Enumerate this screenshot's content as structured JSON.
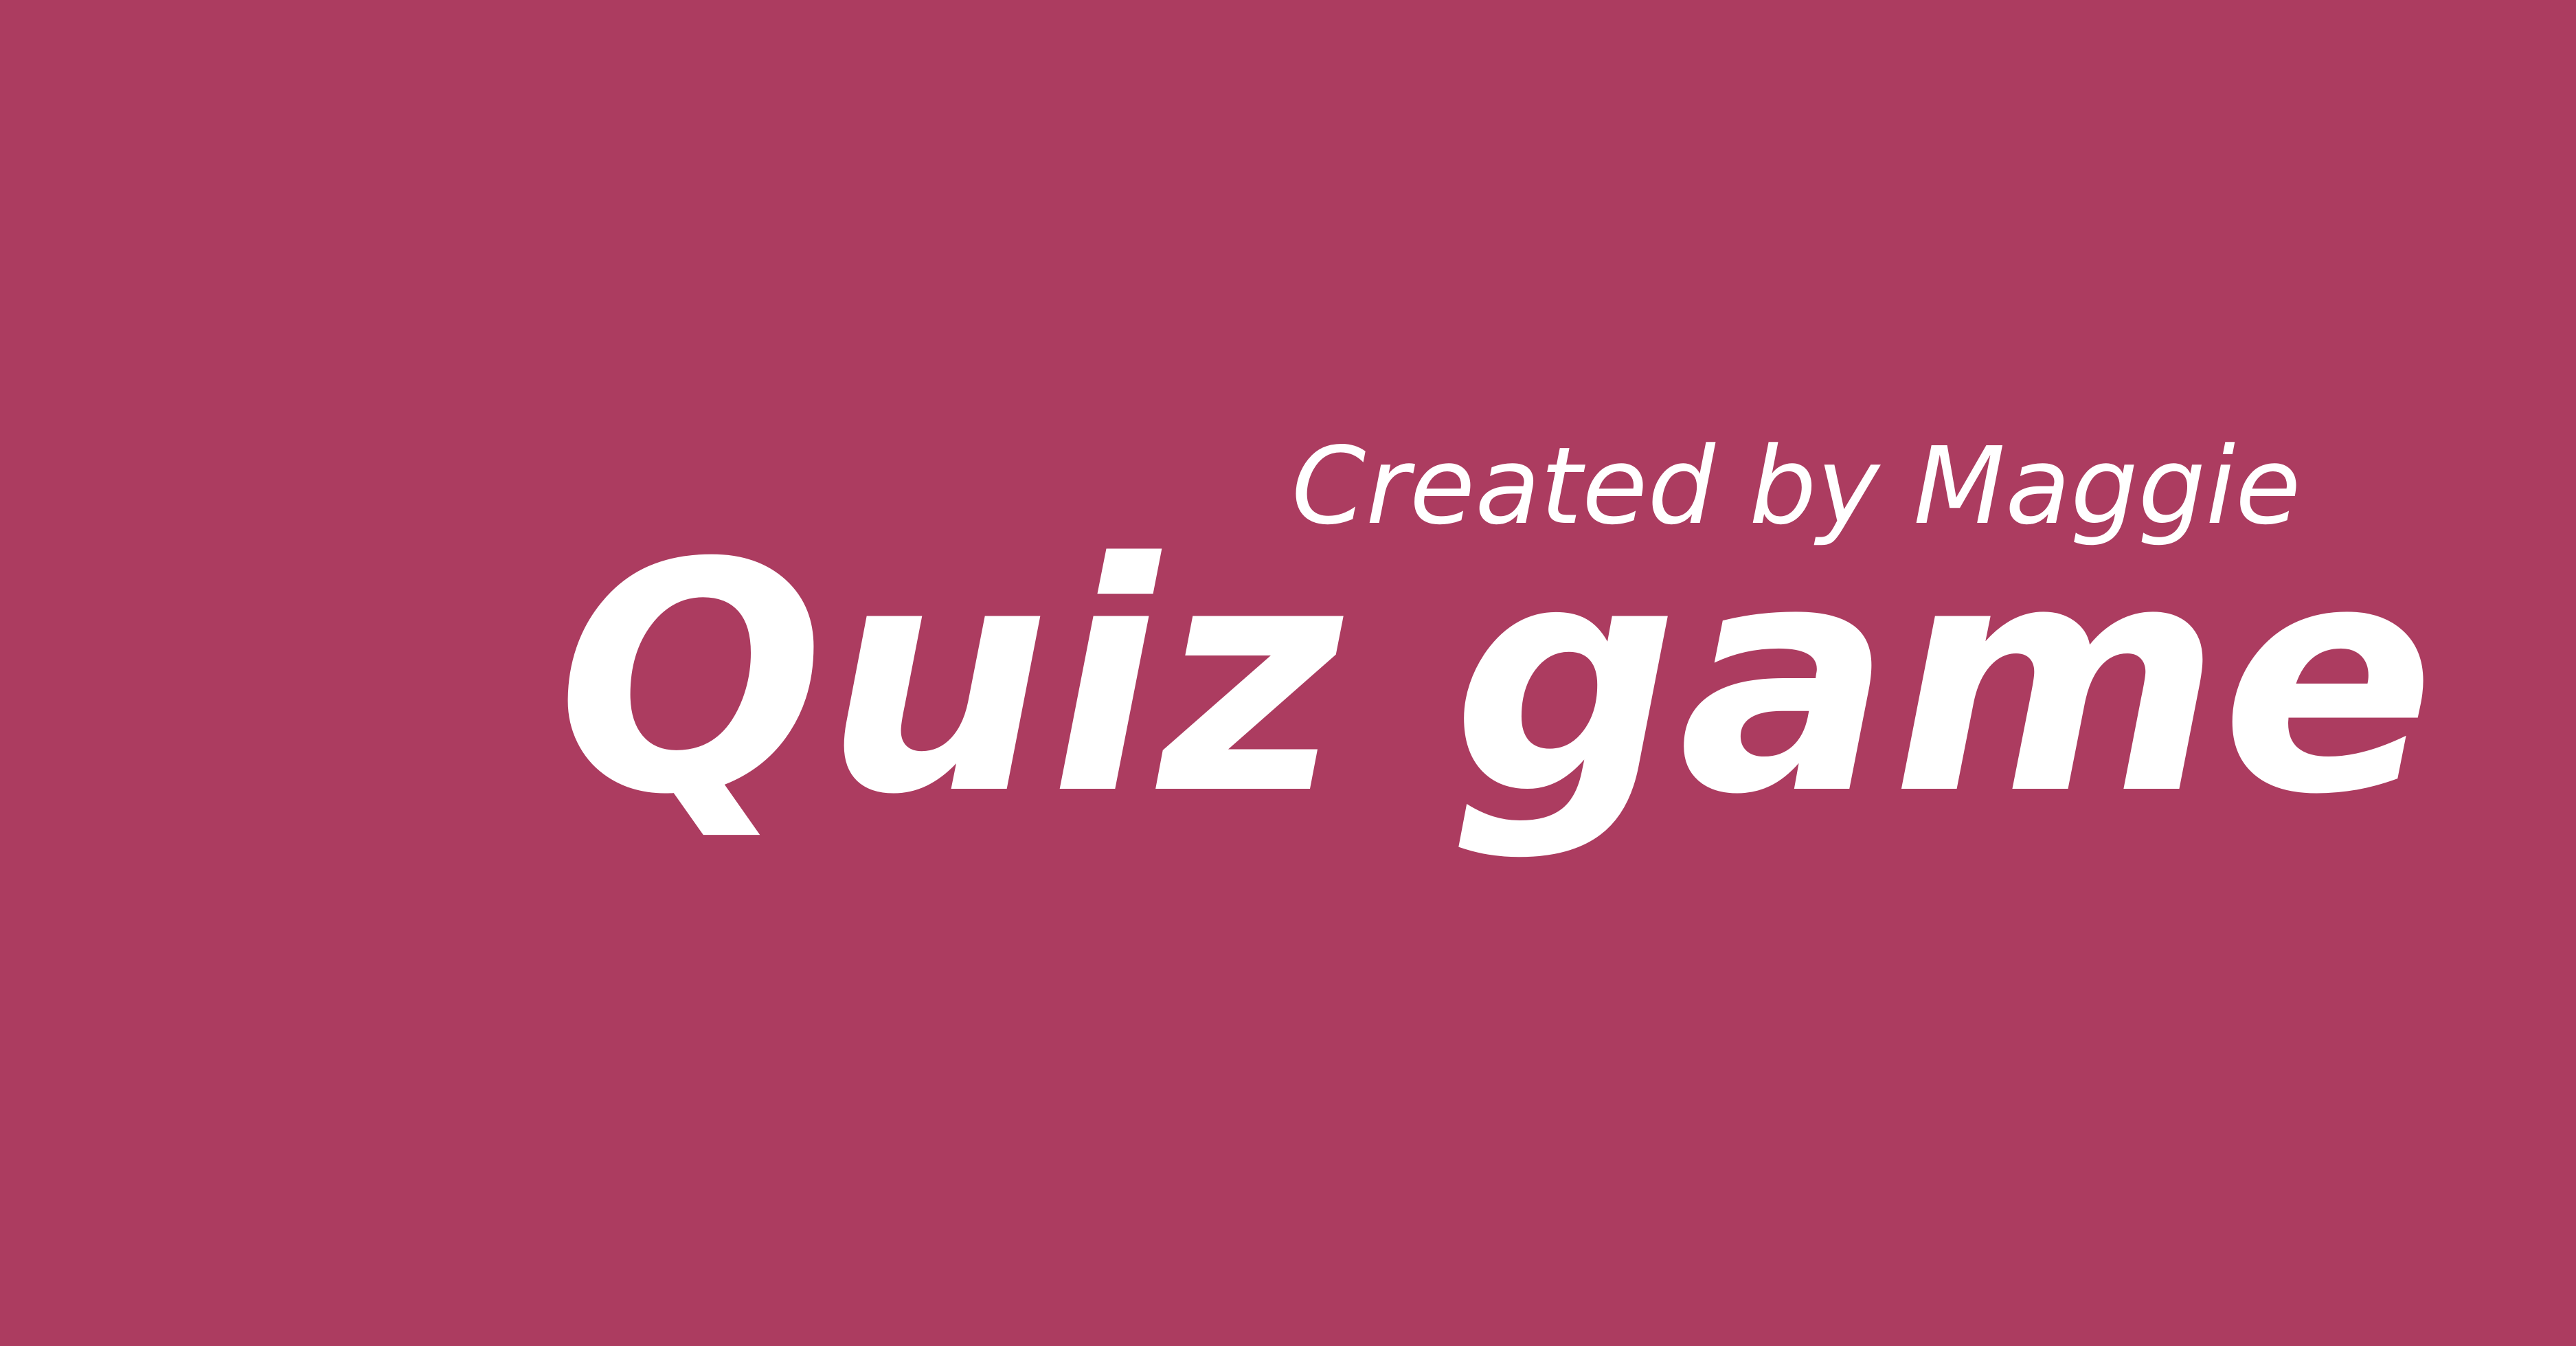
{
  "colors": {
    "background": "#AC3C60",
    "text": "#FFFFFF"
  },
  "title_screen": {
    "subtitle": "Created by Maggie",
    "title": "Quiz game"
  }
}
